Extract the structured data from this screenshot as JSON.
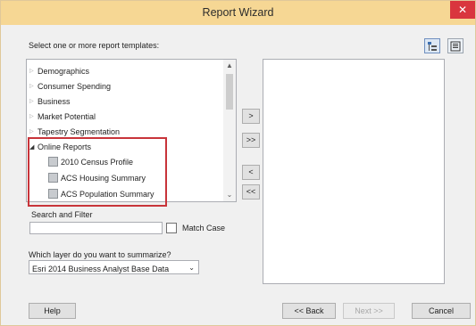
{
  "window": {
    "title": "Report Wizard",
    "close_glyph": "✕"
  },
  "templates": {
    "prompt": "Select one or more report templates:",
    "items": [
      {
        "label": "Demographics"
      },
      {
        "label": "Consumer Spending"
      },
      {
        "label": "Business"
      },
      {
        "label": "Market Potential"
      },
      {
        "label": "Tapestry Segmentation"
      },
      {
        "label": "Online Reports"
      }
    ],
    "online_reports": [
      {
        "label": "2010 Census Profile"
      },
      {
        "label": "ACS Housing Summary"
      },
      {
        "label": "ACS Population Summary"
      }
    ]
  },
  "transfer": {
    "add": ">",
    "add_all": ">>",
    "remove": "<",
    "remove_all": "<<"
  },
  "search": {
    "label": "Search and Filter",
    "value": "",
    "match_case_label": "Match Case",
    "match_case_checked": false
  },
  "layer": {
    "label": "Which layer do you want to summarize?",
    "selected": "Esri 2014 Business Analyst Base Data"
  },
  "footer": {
    "help": "Help",
    "back": "<< Back",
    "next": "Next >>",
    "cancel": "Cancel"
  },
  "colors": {
    "titlebar": "#f6d794",
    "highlight": "#c8343a",
    "close": "#d9363e"
  }
}
